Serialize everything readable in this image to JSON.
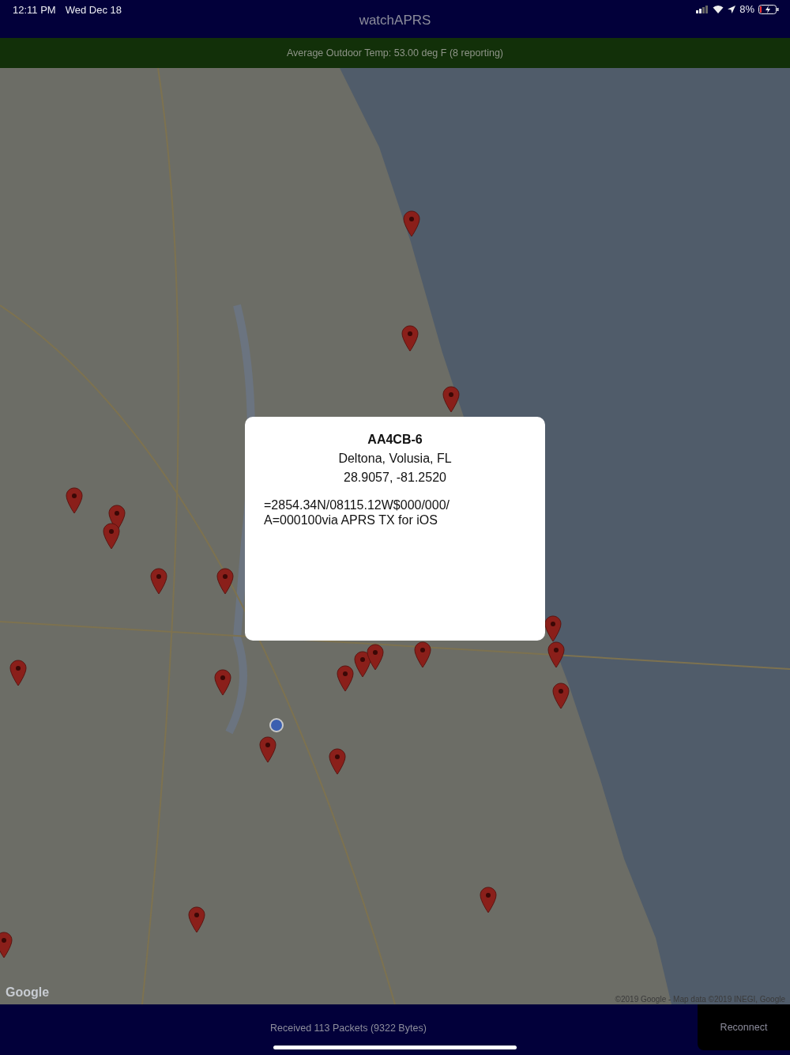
{
  "status_bar": {
    "time": "12:11 PM",
    "date": "Wed Dec 18",
    "battery": "8%"
  },
  "window": {
    "title": "watchAPRS"
  },
  "banner": {
    "text": "Average Outdoor Temp: 53.00 deg F (8 reporting)"
  },
  "map": {
    "logo": "Google",
    "attribution": "©2019 Google - Map data ©2019 INEGI, Google"
  },
  "popup": {
    "callsign": "AA4CB-6",
    "location": "Deltona, Volusia, FL",
    "coordinates": "28.9057, -81.2520",
    "comment": "=2854.34N/08115.12W$000/000/\nA=000100via APRS TX for iOS"
  },
  "footer": {
    "status": "Received 113 Packets (9322 Bytes)",
    "button": "Reconnect"
  }
}
